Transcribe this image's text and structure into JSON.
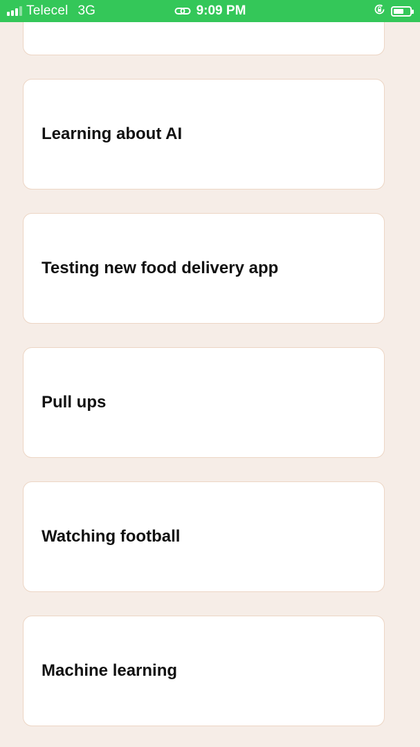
{
  "status_bar": {
    "carrier": "Telecel",
    "network": "3G",
    "time": "9:09 PM",
    "signal_bars": 4,
    "signal_bars_filled": 3,
    "battery_level_percent": 50,
    "icons": [
      "signal-icon",
      "link-icon",
      "orientation-lock-icon",
      "battery-icon"
    ],
    "background_color": "#34c759"
  },
  "background_color": "#f6ede7",
  "cards": [
    {
      "label": ""
    },
    {
      "label": "Learning about AI"
    },
    {
      "label": "Testing new food delivery app"
    },
    {
      "label": "Pull ups"
    },
    {
      "label": "Watching football"
    },
    {
      "label": "Machine learning"
    }
  ]
}
